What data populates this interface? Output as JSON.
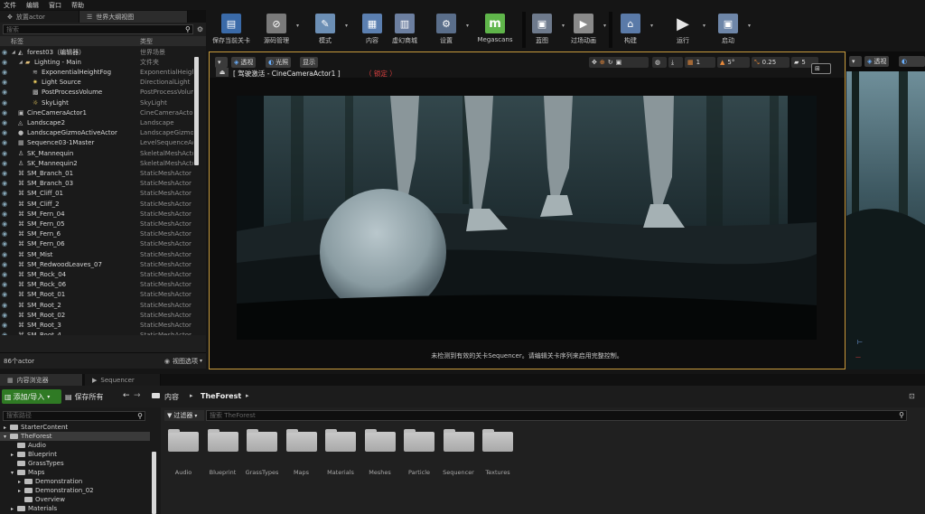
{
  "menu": [
    "文件",
    "编辑",
    "窗口",
    "帮助"
  ],
  "outliner": {
    "tabs": [
      {
        "label": "放置actor"
      },
      {
        "label": "世界大纲视图"
      }
    ],
    "search_placeholder": "搜索",
    "col_label": "标签",
    "col_type": "类型",
    "rows": [
      {
        "name": "forest03（编辑器）",
        "type": "世界场景",
        "icon": "world-icon"
      },
      {
        "name": "Lighting - Main",
        "type": "文件夹",
        "icon": "folder-icon"
      },
      {
        "name": "ExponentialHeightFog",
        "type": "ExponentialHeightFog",
        "icon": "fog-icon"
      },
      {
        "name": "Light Source",
        "type": "DirectionalLight",
        "icon": "light-icon"
      },
      {
        "name": "PostProcessVolume",
        "type": "PostProcessVolume",
        "icon": "volume-icon"
      },
      {
        "name": "SkyLight",
        "type": "SkyLight",
        "icon": "skylight-icon"
      },
      {
        "name": "CineCameraActor1",
        "type": "CineCameraActor",
        "icon": "camera-icon"
      },
      {
        "name": "Landscape2",
        "type": "Landscape",
        "icon": "landscape-icon"
      },
      {
        "name": "LandscapeGizmoActiveActor",
        "type": "LandscapeGizmoActiveActor",
        "icon": "gizmo-icon"
      },
      {
        "name": "Sequence03-1Master",
        "type": "LevelSequenceActor",
        "icon": "sequence-icon"
      },
      {
        "name": "SK_Mannequin",
        "type": "SkeletalMeshActor",
        "icon": "skeletal-icon"
      },
      {
        "name": "SK_Mannequin2",
        "type": "SkeletalMeshActor",
        "icon": "skeletal-icon"
      },
      {
        "name": "SM_Branch_01",
        "type": "StaticMeshActor",
        "icon": "mesh-icon"
      },
      {
        "name": "SM_Branch_03",
        "type": "StaticMeshActor",
        "icon": "mesh-icon"
      },
      {
        "name": "SM_Cliff_01",
        "type": "StaticMeshActor",
        "icon": "mesh-icon"
      },
      {
        "name": "SM_Cliff_2",
        "type": "StaticMeshActor",
        "icon": "mesh-icon"
      },
      {
        "name": "SM_Fern_04",
        "type": "StaticMeshActor",
        "icon": "mesh-icon"
      },
      {
        "name": "SM_Fern_05",
        "type": "StaticMeshActor",
        "icon": "mesh-icon"
      },
      {
        "name": "SM_Fern_6",
        "type": "StaticMeshActor",
        "icon": "mesh-icon"
      },
      {
        "name": "SM_Fern_06",
        "type": "StaticMeshActor",
        "icon": "mesh-icon"
      },
      {
        "name": "SM_Mist",
        "type": "StaticMeshActor",
        "icon": "mesh-icon"
      },
      {
        "name": "SM_RedwoodLeaves_07",
        "type": "StaticMeshActor",
        "icon": "mesh-icon"
      },
      {
        "name": "SM_Rock_04",
        "type": "StaticMeshActor",
        "icon": "mesh-icon"
      },
      {
        "name": "SM_Rock_06",
        "type": "StaticMeshActor",
        "icon": "mesh-icon"
      },
      {
        "name": "SM_Root_01",
        "type": "StaticMeshActor",
        "icon": "mesh-icon"
      },
      {
        "name": "SM_Root_2",
        "type": "StaticMeshActor",
        "icon": "mesh-icon"
      },
      {
        "name": "SM_Root_02",
        "type": "StaticMeshActor",
        "icon": "mesh-icon"
      },
      {
        "name": "SM_Root_3",
        "type": "StaticMeshActor",
        "icon": "mesh-icon"
      },
      {
        "name": "SM_Root_4",
        "type": "StaticMeshActor",
        "icon": "mesh-icon"
      }
    ],
    "actor_count": "86个actor",
    "view_options": "视图选项"
  },
  "toolbar": {
    "buttons": [
      {
        "label": "保存当前关卡",
        "icon": "save-icon",
        "color": "#3a6aa8"
      },
      {
        "label": "源码管理",
        "icon": "source-control-icon",
        "color": "#7a7a7a"
      },
      {
        "label": "模式",
        "icon": "modes-icon",
        "color": "#6c8fb5"
      },
      {
        "label": "内容",
        "icon": "content-icon",
        "color": "#5b7fb0"
      },
      {
        "label": "虚幻商城",
        "icon": "marketplace-icon",
        "color": "#6c7fa0"
      },
      {
        "label": "设置",
        "icon": "settings-icon",
        "color": "#5a6e8a"
      },
      {
        "label": "Megascans",
        "icon": "megascans-icon",
        "color": "#5fb54a"
      },
      {
        "label": "蓝图",
        "icon": "blueprint-icon",
        "color": "#6e7a8c"
      },
      {
        "label": "过场动画",
        "icon": "cinematics-icon",
        "color": "#8a8a8a"
      },
      {
        "label": "构建",
        "icon": "build-icon",
        "color": "#5a7aa8"
      },
      {
        "label": "运行",
        "icon": "play-icon",
        "color": "#d8d8d8"
      },
      {
        "label": "启动",
        "icon": "launch-icon",
        "color": "#6e86a8"
      }
    ]
  },
  "viewport": {
    "perspective": "透视",
    "lit": "光照",
    "show": "显示",
    "grid_snap": "1",
    "rot_snap": "5°",
    "scale_snap": "0.25",
    "cam_speed": "5",
    "pilot_label": "[ 驾驶激活 - CineCameraActor1 ]",
    "lock_label": "（ 锁定 ）",
    "message": "未检测到有效的关卡Sequencer。请编辑关卡序列来启用完整控制。",
    "accent_color": "#c89b3c"
  },
  "right_viewport": {
    "perspective": "透视"
  },
  "content_browser": {
    "tabs": [
      {
        "label": "内容浏览器"
      },
      {
        "label": "Sequencer"
      }
    ],
    "add_import": "添加/导入",
    "save_all": "保存所有",
    "path_root": "内容",
    "path_current": "TheForest",
    "search_paths_placeholder": "搜索路径",
    "filters": "过滤器",
    "search_placeholder": "搜索 TheForest",
    "tree": [
      {
        "label": "StarterContent",
        "indent": 0,
        "arrow": "▸"
      },
      {
        "label": "TheForest",
        "indent": 0,
        "arrow": "▾",
        "selected": true
      },
      {
        "label": "Audio",
        "indent": 1,
        "arrow": ""
      },
      {
        "label": "Blueprint",
        "indent": 1,
        "arrow": "▸"
      },
      {
        "label": "GrassTypes",
        "indent": 1,
        "arrow": ""
      },
      {
        "label": "Maps",
        "indent": 1,
        "arrow": "▾"
      },
      {
        "label": "Demonstration",
        "indent": 2,
        "arrow": "▸"
      },
      {
        "label": "Demonstration_02",
        "indent": 2,
        "arrow": "▸"
      },
      {
        "label": "Overview",
        "indent": 2,
        "arrow": ""
      },
      {
        "label": "Materials",
        "indent": 1,
        "arrow": "▸"
      }
    ],
    "folders": [
      "Audio",
      "Blueprint",
      "GrassTypes",
      "Maps",
      "Materials",
      "Meshes",
      "Particle",
      "Sequencer",
      "Textures"
    ]
  }
}
